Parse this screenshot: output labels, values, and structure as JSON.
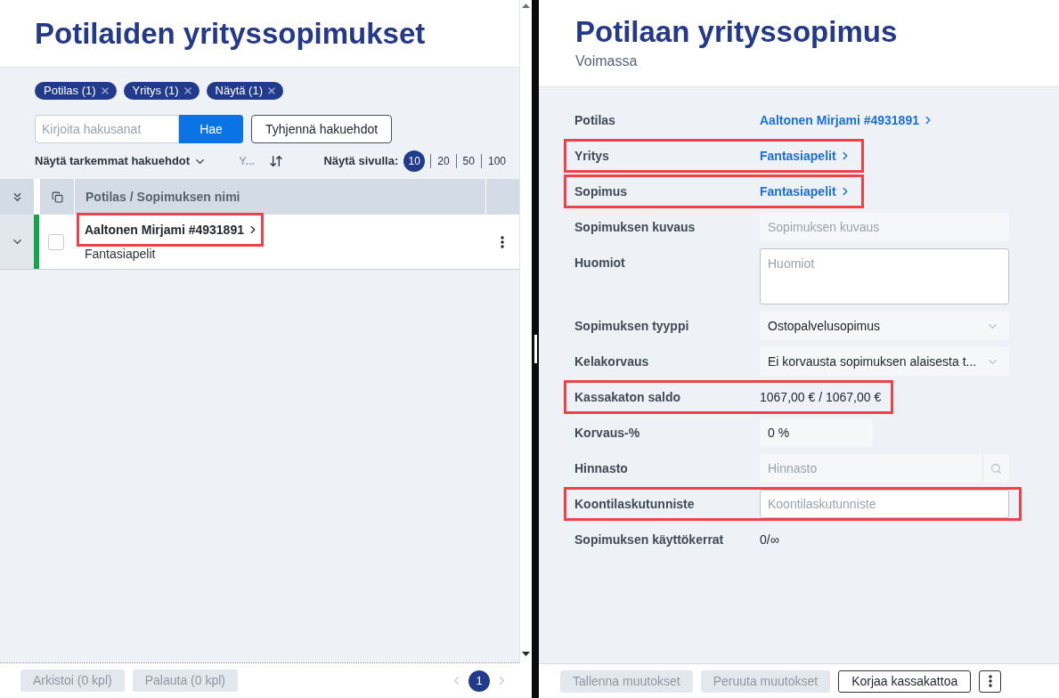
{
  "list_panel": {
    "title": "Potilaiden yrityssopimukset",
    "filter_chips": [
      {
        "label": "Potilas (1)"
      },
      {
        "label": "Yritys (1)"
      },
      {
        "label": "Näytä (1)"
      }
    ],
    "search": {
      "placeholder": "Kirjoita hakusanat",
      "button": "Hae"
    },
    "clear_button": "Tyhjennä hakuehdot",
    "advanced_toggle": "Näytä tarkemmat hakuehdot",
    "sort_field": {
      "label": "Y...",
      "disabled": true
    },
    "page_size": {
      "label": "Näytä sivulla:",
      "options": [
        {
          "label": "10",
          "selected": true
        },
        {
          "label": "20",
          "selected": false
        },
        {
          "label": "50",
          "selected": false
        },
        {
          "label": "100",
          "selected": false
        }
      ]
    },
    "table": {
      "columns": [
        "Potilas / Sopimuksen nimi"
      ],
      "rows": [
        {
          "patient": "Aaltonen Mirjami #4931891",
          "contract": "Fantasiapelit",
          "expanded": false,
          "checked": false,
          "color": "#16a34a",
          "highlighted": true
        }
      ]
    },
    "footer": {
      "buttons": [
        {
          "label": "Arkistoi (0 kpl)",
          "disabled": true
        },
        {
          "label": "Palauta (0 kpl)",
          "disabled": true
        }
      ],
      "pages": [
        {
          "label": "1",
          "selected": true
        }
      ]
    }
  },
  "detail_panel": {
    "title": "Potilaan yrityssopimus",
    "status": "Voimassa",
    "fields": [
      {
        "kind": "link",
        "label": "Potilas",
        "value": "Aaltonen Mirjami #4931891",
        "highlighted": false
      },
      {
        "kind": "link",
        "label": "Yritys",
        "value": "Fantasiapelit",
        "highlighted": true
      },
      {
        "kind": "link",
        "label": "Sopimus",
        "value": "Fantasiapelit",
        "highlighted": true
      },
      {
        "kind": "input",
        "label": "Sopimuksen kuvaus",
        "placeholder": "Sopimuksen kuvaus",
        "disabled": true,
        "highlighted": false
      },
      {
        "kind": "textarea",
        "label": "Huomiot",
        "placeholder": "Huomiot",
        "disabled": false,
        "highlighted": false
      },
      {
        "kind": "select",
        "label": "Sopimuksen tyyppi",
        "value": "Ostopalvelusopimus",
        "disabled": true,
        "highlighted": false
      },
      {
        "kind": "select",
        "label": "Kelakorvaus",
        "value": "Ei korvausta sopimuksen alaisesta t...",
        "disabled": true,
        "highlighted": false
      },
      {
        "kind": "text",
        "label": "Kassakaton saldo",
        "value": "1067,00 € / 1067,00 €",
        "highlighted": true
      },
      {
        "kind": "number",
        "label": "Korvaus-%",
        "value": "0 %",
        "disabled": true,
        "highlighted": false
      },
      {
        "kind": "search",
        "label": "Hinnasto",
        "placeholder": "Hinnasto",
        "disabled": true,
        "highlighted": false
      },
      {
        "kind": "input",
        "label": "Koontilaskutunniste",
        "placeholder": "Koontilaskutunniste",
        "disabled": false,
        "highlighted": true
      },
      {
        "kind": "text",
        "label": "Sopimuksen käyttökerrat",
        "value": "0/∞",
        "highlighted": false
      }
    ],
    "footer": {
      "buttons": [
        {
          "label": "Tallenna muutokset",
          "disabled": true
        },
        {
          "label": "Peruuta muutokset",
          "disabled": true
        },
        {
          "label": "Korjaa kassakattoa",
          "disabled": false
        }
      ]
    }
  }
}
